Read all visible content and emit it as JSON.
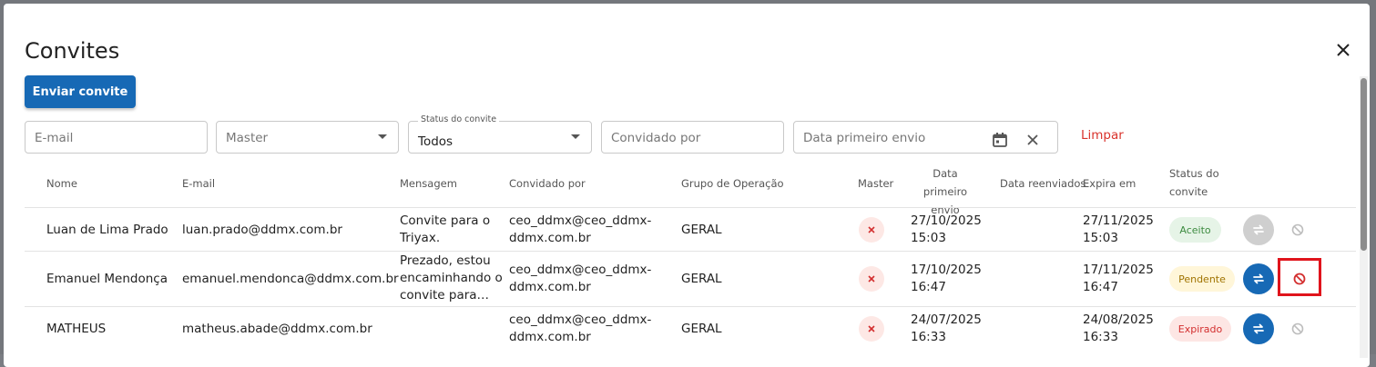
{
  "dialog": {
    "title": "Convites",
    "send_button": "Enviar convite",
    "close_icon": "close-icon"
  },
  "filters": {
    "email_placeholder": "E-mail",
    "master_placeholder": "Master",
    "status_label": "Status do convite",
    "status_value": "Todos",
    "invited_by_placeholder": "Convidado por",
    "first_send_placeholder": "Data primeiro envio",
    "clear_label": "Limpar"
  },
  "table": {
    "headers": {
      "name": "Nome",
      "email": "E-mail",
      "message": "Mensagem",
      "invited_by": "Convidado por",
      "group": "Grupo de Operação",
      "master": "Master",
      "first_send_1": "Data primeiro",
      "first_send_2": "envio",
      "resent": "Data reenviados",
      "expires": "Expira em",
      "status_1": "Status do",
      "status_2": "convite"
    },
    "rows": [
      {
        "name": "Luan de Lima Prado",
        "email": "luan.prado@ddmx.com.br",
        "message_1": "Convite para o",
        "message_2": "Triyax.",
        "message_3": "",
        "invited_1": "ceo_ddmx@ceo_ddmx-",
        "invited_2": "ddmx.com.br",
        "group": "GERAL",
        "first_send_1": "27/10/2025",
        "first_send_2": "15:03",
        "expires_1": "27/11/2025",
        "expires_2": "15:03",
        "status": "Aceito"
      },
      {
        "name": "Emanuel Mendonça",
        "email": "emanuel.mendonca@ddmx.com.br",
        "message_1": "Prezado, estou",
        "message_2": "encaminhando o",
        "message_3": "convite para…",
        "invited_1": "ceo_ddmx@ceo_ddmx-",
        "invited_2": "ddmx.com.br",
        "group": "GERAL",
        "first_send_1": "17/10/2025",
        "first_send_2": "16:47",
        "expires_1": "17/11/2025",
        "expires_2": "16:47",
        "status": "Pendente"
      },
      {
        "name": "MATHEUS",
        "email": "matheus.abade@ddmx.com.br",
        "message_1": "",
        "message_2": "",
        "message_3": "",
        "invited_1": "ceo_ddmx@ceo_ddmx-",
        "invited_2": "ddmx.com.br",
        "group": "GERAL",
        "first_send_1": "24/07/2025",
        "first_send_2": "16:33",
        "expires_1": "24/08/2025",
        "expires_2": "16:33",
        "status": "Expirado"
      }
    ]
  },
  "colors": {
    "primary": "#1769b5",
    "danger": "#d9332c",
    "accepted_bg": "#e6f4e7",
    "accepted_fg": "#3d8b40",
    "pending_bg": "#fff6d9",
    "pending_fg": "#a07300",
    "expired_bg": "#fde6e4",
    "expired_fg": "#d32f2f",
    "disabled": "#cfcfcf"
  }
}
